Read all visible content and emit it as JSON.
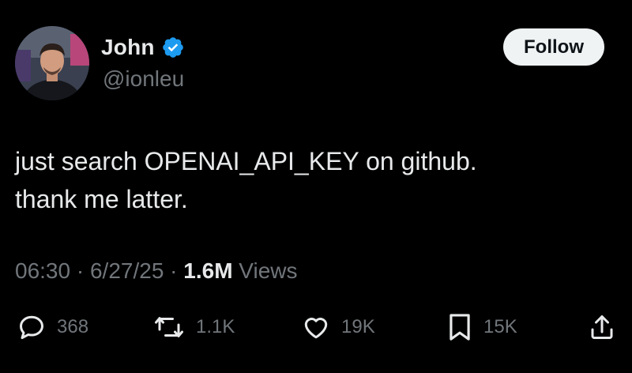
{
  "author": {
    "display_name": "John",
    "handle": "@ionleu",
    "verified": true
  },
  "follow_label": "Follow",
  "tweet": {
    "lines": [
      "just search OPENAI_API_KEY on github.",
      "thank me latter."
    ]
  },
  "meta": {
    "time": "06:30",
    "separator": " · ",
    "date": "6/27/25",
    "views_count": "1.6M",
    "views_label": " Views"
  },
  "actions": {
    "replies": "368",
    "reposts": "1.1K",
    "likes": "19K",
    "bookmarks": "15K"
  },
  "colors": {
    "background": "#000000",
    "text_primary": "#e7e9ea",
    "text_secondary": "#71767b",
    "verified_blue": "#1d9bf0",
    "button_bg": "#eff3f4"
  },
  "icons": {
    "verified": "verified-badge-icon",
    "reply": "reply-icon",
    "repost": "repost-icon",
    "like": "heart-icon",
    "bookmark": "bookmark-icon",
    "share": "share-icon"
  }
}
